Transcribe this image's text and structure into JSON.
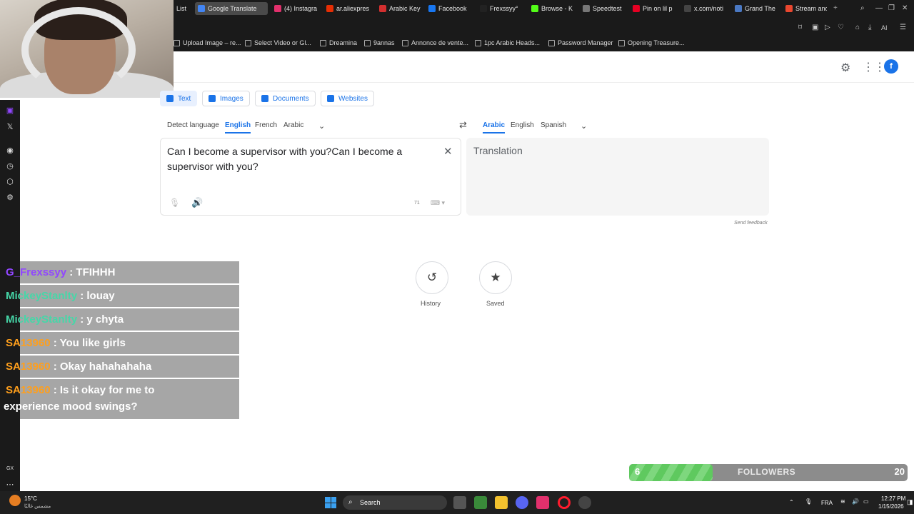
{
  "browser": {
    "tabs": [
      {
        "label": "List",
        "color": "#777777"
      },
      {
        "label": "Google Translate",
        "color": "#4285f4",
        "active": true
      },
      {
        "label": "(4) Instagra",
        "color": "#e1306c"
      },
      {
        "label": "ar.aliexpres",
        "color": "#e62e04"
      },
      {
        "label": "Arabic Key",
        "color": "#d32f2f"
      },
      {
        "label": "Facebook",
        "color": "#1877f2"
      },
      {
        "label": "Frexssyy°",
        "color": "#222222"
      },
      {
        "label": "Browse - K",
        "color": "#53fc18"
      },
      {
        "label": "Speedtest",
        "color": "#777777"
      },
      {
        "label": "Pin on lil p",
        "color": "#e60023"
      },
      {
        "label": "x.com/noti",
        "color": "#444444"
      },
      {
        "label": "Grand The",
        "color": "#4a78c2"
      },
      {
        "label": "Stream and",
        "color": "#e9472f"
      }
    ],
    "bookmarks": [
      "Upload Image – re...",
      "Select Video or Gl...",
      "Dreamina",
      "9annas",
      "Annonce de vente...",
      "1pc Arabic Heads...",
      "Password Manager",
      "Opening Treasure..."
    ],
    "toolbar": {
      "ai_label": "AI"
    }
  },
  "translate": {
    "header": {
      "avatar_letter": "f"
    },
    "modes": [
      {
        "label": "Text",
        "active": true
      },
      {
        "label": "Images"
      },
      {
        "label": "Documents"
      },
      {
        "label": "Websites"
      }
    ],
    "source_langs": [
      "Detect language",
      "English",
      "French",
      "Arabic"
    ],
    "source_selected": "English",
    "target_langs": [
      "Arabic",
      "English",
      "Spanish"
    ],
    "target_selected": "Arabic",
    "source_text": "Can I become a supervisor with you?Can I become a supervisor with you?",
    "char_count": "71",
    "target_placeholder": "Translation",
    "send_feedback": "Send feedback",
    "history_label": "History",
    "saved_label": "Saved"
  },
  "stream": {
    "chat": [
      {
        "user": "G_Frexssyy",
        "text": "TFIHHH",
        "color": "#9146ff"
      },
      {
        "user": "MickeyStanlty",
        "text": "louay",
        "color": "#46d7a8"
      },
      {
        "user": "MickeyStanlty",
        "text": "y chyta",
        "color": "#46d7a8"
      },
      {
        "user": "SA13960",
        "text": "You like girls",
        "color": "#ff9f1c"
      },
      {
        "user": "SA13960",
        "text": "Okay hahahahaha",
        "color": "#ff9f1c"
      },
      {
        "user": "SA13960",
        "text": "Is it okay for me to",
        "text2": "experience mood swings?",
        "color": "#ff9f1c"
      }
    ],
    "followers": {
      "current": "6",
      "label": "FOLLOWERS",
      "goal": "20",
      "progress": 0.3
    }
  },
  "taskbar": {
    "weather_temp": "15°C",
    "weather_desc": "مشمس غالبًا",
    "search": "Search",
    "lang": "FRA",
    "time": "12:27 PM",
    "date": "1/15/2026"
  }
}
